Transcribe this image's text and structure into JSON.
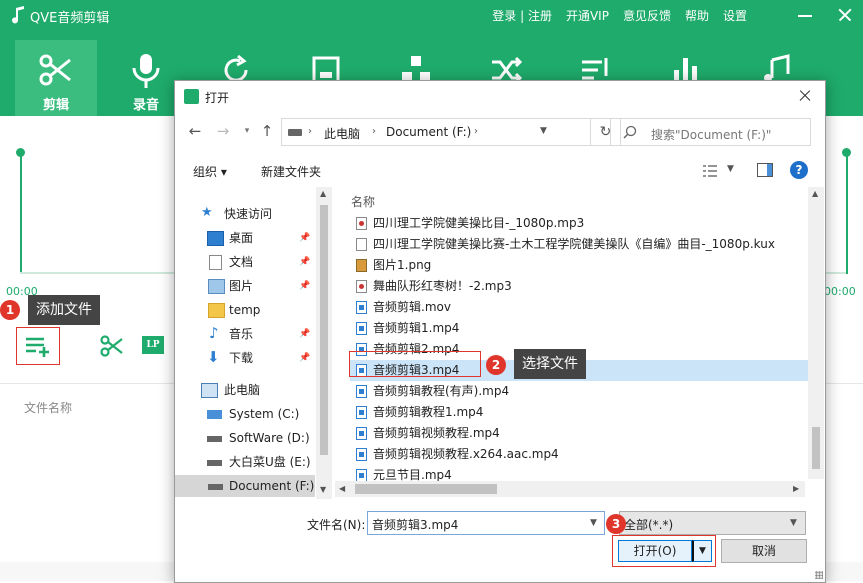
{
  "app": {
    "title": "QVE音频剪辑",
    "menu": [
      "登录 | 注册",
      "开通VIP",
      "意见反馈",
      "帮助",
      "设置"
    ],
    "tabs": [
      {
        "label": "剪辑",
        "icon": "scissors-icon"
      },
      {
        "label": "录音",
        "icon": "microphone-icon"
      },
      {
        "label": "",
        "icon": "refresh-icon"
      },
      {
        "label": "",
        "icon": "square-icon"
      },
      {
        "label": "",
        "icon": "nodes-icon"
      },
      {
        "label": "",
        "icon": "shuffle-icon"
      },
      {
        "label": "",
        "icon": "playlist-icon"
      },
      {
        "label": "",
        "icon": "bar-chart-icon"
      },
      {
        "label": "",
        "icon": "music-note-icon"
      }
    ],
    "time_left": "00:00",
    "time_right": "00:00",
    "file_name_header": "文件名称",
    "lp_label": "LP",
    "accent_color": "#1fab6b",
    "callout_color": "#e0352b"
  },
  "callouts": [
    {
      "num": "1",
      "text": "添加文件"
    },
    {
      "num": "2",
      "text": "选择文件"
    },
    {
      "num": "3",
      "text": ""
    }
  ],
  "dialog": {
    "title": "打开",
    "breadcrumb": [
      "此电脑",
      "Document (F:)"
    ],
    "search_placeholder": "搜索\"Document (F:)\"",
    "organize_label": "组织 ▾",
    "new_folder_label": "新建文件夹",
    "help_label": "?",
    "nav": {
      "quick_access": "快速访问",
      "items": [
        {
          "label": "桌面",
          "icon": "desktop-icon"
        },
        {
          "label": "文档",
          "icon": "document-icon"
        },
        {
          "label": "图片",
          "icon": "pictures-icon"
        },
        {
          "label": "temp",
          "icon": "folder-icon"
        },
        {
          "label": "音乐",
          "icon": "music-icon"
        },
        {
          "label": "下载",
          "icon": "download-icon"
        }
      ],
      "this_pc": "此电脑",
      "drives": [
        "System (C:)",
        "SoftWare (D:)",
        "大白菜U盘 (E:)",
        "Document (F:)"
      ]
    },
    "column_name": "名称",
    "files": [
      {
        "name": "四川理工学院健美操比目-_1080p.mp3",
        "type": "mp3"
      },
      {
        "name": "四川理工学院健美操比赛-土木工程学院健美操队《自编》曲目-_1080p.kux",
        "type": "doc"
      },
      {
        "name": "图片1.png",
        "type": "png"
      },
      {
        "name": "舞曲队形红枣树！-2.mp3",
        "type": "mp3"
      },
      {
        "name": "音频剪辑.mov",
        "type": "mp4"
      },
      {
        "name": "音频剪辑1.mp4",
        "type": "mp4"
      },
      {
        "name": "音频剪辑2.mp4",
        "type": "mp4"
      },
      {
        "name": "音频剪辑3.mp4",
        "type": "mp4"
      },
      {
        "name": "音频剪辑教程(有声).mp4",
        "type": "mp4"
      },
      {
        "name": "音频剪辑教程1.mp4",
        "type": "mp4"
      },
      {
        "name": "音频剪辑视频教程.mp4",
        "type": "mp4"
      },
      {
        "name": "音频剪辑视频教程.x264.aac.mp4",
        "type": "mp4"
      },
      {
        "name": "元旦节目.mp4",
        "type": "mp4"
      }
    ],
    "selected_file": "音频剪辑3.mp4",
    "filename_label": "文件名(N):",
    "filename_value": "音频剪辑3.mp4",
    "filter_value": "全部(*.*)",
    "open_label": "打开(O)",
    "cancel_label": "取消"
  }
}
